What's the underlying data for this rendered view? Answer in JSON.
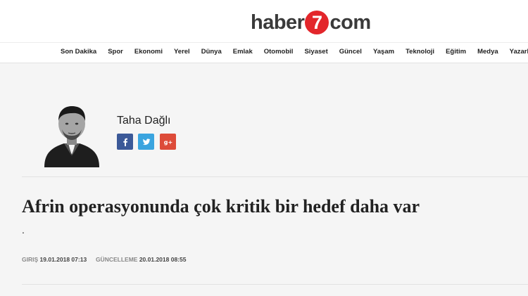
{
  "brand": {
    "part1": "haber",
    "part2": "7",
    "part3": "com",
    "accent": "#e3262b"
  },
  "nav": [
    "Son Dakika",
    "Spor",
    "Ekonomi",
    "Yerel",
    "Dünya",
    "Emlak",
    "Otomobil",
    "Siyaset",
    "Güncel",
    "Yaşam",
    "Teknoloji",
    "Eğitim",
    "Medya",
    "Yazarlar"
  ],
  "author": {
    "name": "Taha Dağlı"
  },
  "social": [
    {
      "icon": "facebook-icon",
      "color": "#3b5998"
    },
    {
      "icon": "twitter-icon",
      "color": "#3aa4df"
    },
    {
      "icon": "google-plus-icon",
      "color": "#dd4b39"
    }
  ],
  "article": {
    "title": "Afrin operasyonunda çok kritik bir hedef daha var",
    "summary": ".",
    "created_label": "Giriş",
    "created": "19.01.2018 07:13",
    "updated_label": "Güncelleme",
    "updated": "20.01.2018 08:55"
  }
}
